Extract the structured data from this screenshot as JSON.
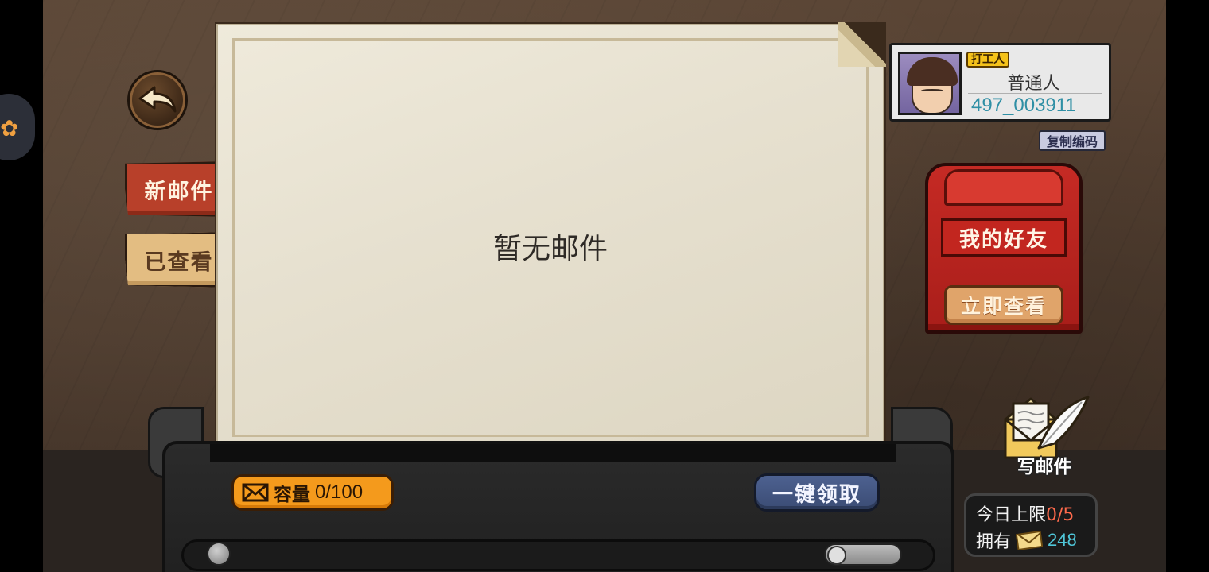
{
  "navigation": {
    "back_icon": "back-arrow-icon"
  },
  "tabs": [
    {
      "label": "新邮件",
      "active": true
    },
    {
      "label": "已查看",
      "active": false
    }
  ],
  "mail_panel": {
    "empty_text": "暂无邮件"
  },
  "capacity": {
    "icon": "envelope-icon",
    "label": "容量",
    "value": "0/100"
  },
  "claim_all": {
    "label": "一键领取"
  },
  "profile": {
    "title_badge": "打工人",
    "name": "普通人",
    "id": "497_003911",
    "copy_label": "复制编码"
  },
  "friends_mailbox": {
    "label": "我的好友",
    "button": "立即查看"
  },
  "write_mail": {
    "label": "写邮件",
    "icon": "letter-quill-icon"
  },
  "daily": {
    "limit_label": "今日上限",
    "limit_value": "0/5",
    "owned_label": "拥有",
    "owned_icon": "envelope-icon",
    "owned_value": "248"
  },
  "colors": {
    "active_tab": "#b8402a",
    "inactive_tab": "#e3bd82",
    "capacity_badge": "#f49a1c",
    "claim_button": "#4d6190",
    "mailbox": "#c52a24",
    "limit_value": "#ff6a4c",
    "owned_value": "#4fc6d8",
    "player_id": "#2f8fa5"
  }
}
